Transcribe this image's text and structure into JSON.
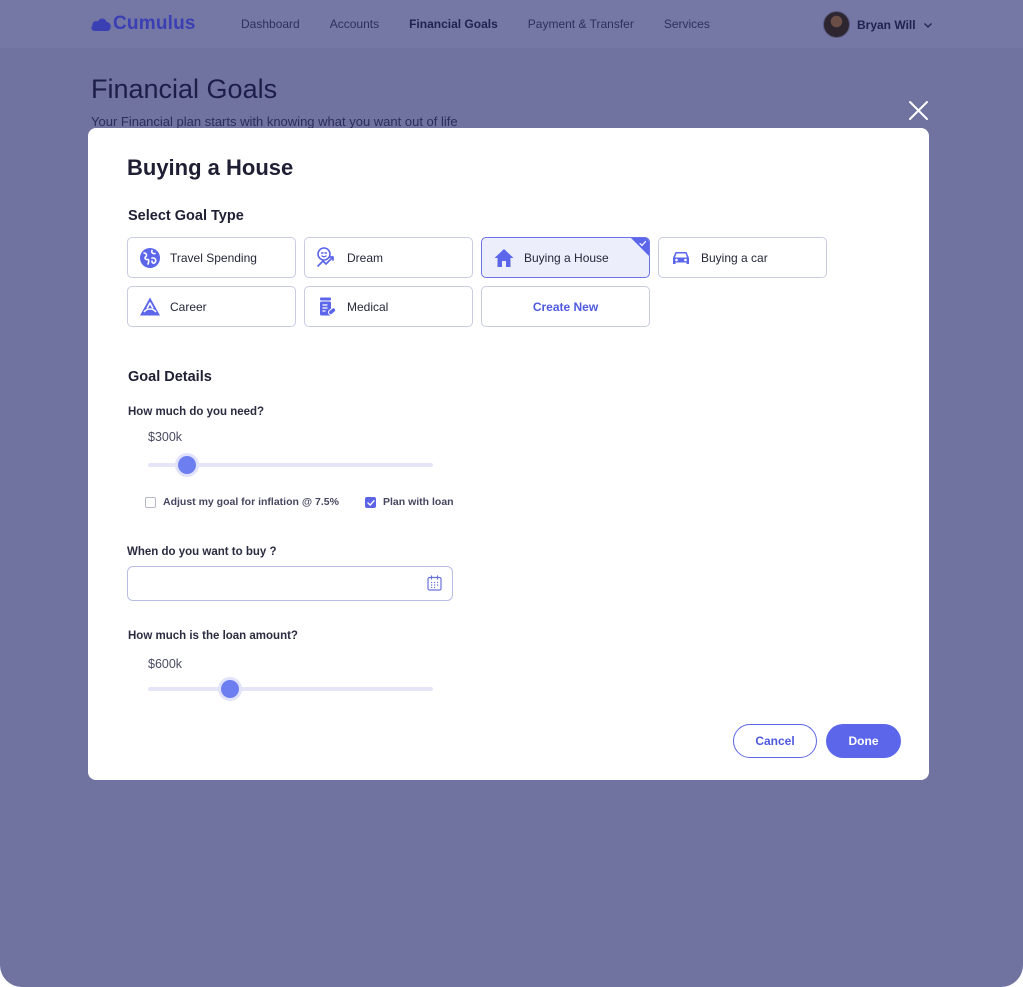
{
  "app": {
    "brand": "Cumulus",
    "brand_color": "#3a3fb4"
  },
  "nav": {
    "links": [
      {
        "label": "Dashboard",
        "active": false
      },
      {
        "label": "Accounts",
        "active": false
      },
      {
        "label": "Financial Goals",
        "active": true
      },
      {
        "label": "Payment & Transfer",
        "active": false
      },
      {
        "label": "Services",
        "active": false
      }
    ],
    "user_name": "Bryan Will"
  },
  "page": {
    "title": "Financial Goals",
    "subtitle": "Your Financial plan starts with knowing what you want out of life"
  },
  "modal": {
    "title": "Buying a House",
    "goal_type_heading": "Select Goal Type",
    "goal_types": [
      {
        "label": "Travel Spending",
        "icon": "globe-icon",
        "selected": false
      },
      {
        "label": "Dream",
        "icon": "dream-icon",
        "selected": false
      },
      {
        "label": "Buying a House",
        "icon": "house-icon",
        "selected": true
      },
      {
        "label": "Buying a car",
        "icon": "car-icon",
        "selected": false
      },
      {
        "label": "Career",
        "icon": "career-icon",
        "selected": false
      },
      {
        "label": "Medical",
        "icon": "medical-icon",
        "selected": false
      }
    ],
    "create_new_label": "Create New",
    "details_heading": "Goal Details",
    "need": {
      "label": "How much do you need?",
      "value": "$300k",
      "slider_fraction": 0.14
    },
    "inflation_check": {
      "label": "Adjust my goal for inflation @ 7.5%",
      "checked": false
    },
    "loan_check": {
      "label": "Plan with loan",
      "checked": true
    },
    "buy_date": {
      "label": "When do you want to buy ?",
      "value": "",
      "placeholder": ""
    },
    "loan": {
      "label": "How much is the loan amount?",
      "value": "$600k",
      "slider_fraction": 0.29
    },
    "cancel_label": "Cancel",
    "done_label": "Done"
  },
  "colors": {
    "overlay": "#7072a0",
    "accent": "#5c66ea",
    "selected_bg": "#eceefc"
  }
}
